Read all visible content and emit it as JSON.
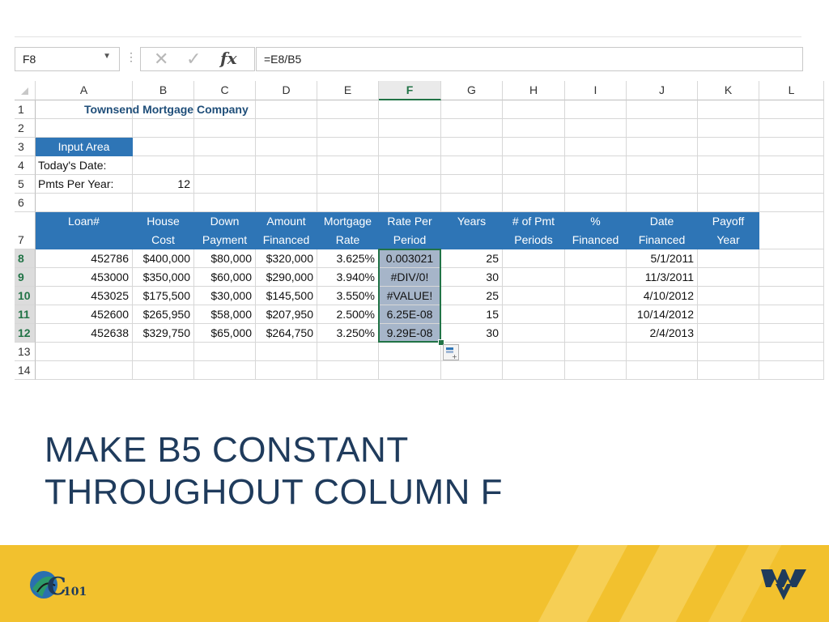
{
  "formula_bar": {
    "name_box": "F8",
    "formula": "=E8/B5",
    "fx_label": "fx",
    "cancel_glyph": "✕",
    "enter_glyph": "✓"
  },
  "columns": [
    "A",
    "B",
    "C",
    "D",
    "E",
    "F",
    "G",
    "H",
    "I",
    "J",
    "K",
    "L"
  ],
  "selected_column": "F",
  "rows": {
    "r1": {
      "num": "1",
      "A": "Townsend Mortgage Company"
    },
    "r2": {
      "num": "2"
    },
    "r3": {
      "num": "3",
      "A": "Input Area"
    },
    "r4": {
      "num": "4",
      "A": "Today's Date:"
    },
    "r5": {
      "num": "5",
      "A": "Pmts Per Year:",
      "B": "12"
    },
    "r6": {
      "num": "6"
    },
    "r7": {
      "num": "7",
      "A": [
        "",
        "Loan#"
      ],
      "B": [
        "House",
        "Cost"
      ],
      "C": [
        "Down",
        "Payment"
      ],
      "D": [
        "Amount",
        "Financed"
      ],
      "E": [
        "Mortgage",
        "Rate"
      ],
      "F": [
        "Rate Per",
        "Period"
      ],
      "G": [
        "",
        "Years"
      ],
      "H": [
        "# of Pmt",
        "Periods"
      ],
      "I": [
        "%",
        "Financed"
      ],
      "J": [
        "Date",
        "Financed"
      ],
      "K": [
        "Payoff",
        "Year"
      ]
    },
    "r8": {
      "num": "8",
      "A": "452786",
      "B": "$400,000",
      "C": "$80,000",
      "D": "$320,000",
      "E": "3.625%",
      "F": "0.003021",
      "G": "25",
      "J": "5/1/2011"
    },
    "r9": {
      "num": "9",
      "A": "453000",
      "B": "$350,000",
      "C": "$60,000",
      "D": "$290,000",
      "E": "3.940%",
      "F": "#DIV/0!",
      "G": "30",
      "J": "11/3/2011"
    },
    "r10": {
      "num": "10",
      "A": "453025",
      "B": "$175,500",
      "C": "$30,000",
      "D": "$145,500",
      "E": "3.550%",
      "F": "#VALUE!",
      "G": "25",
      "J": "4/10/2012"
    },
    "r11": {
      "num": "11",
      "A": "452600",
      "B": "$265,950",
      "C": "$58,000",
      "D": "$207,950",
      "E": "2.500%",
      "F": "6.25E-08",
      "G": "15",
      "J": "10/14/2012"
    },
    "r12": {
      "num": "12",
      "A": "452638",
      "B": "$329,750",
      "C": "$65,000",
      "D": "$264,750",
      "E": "3.250%",
      "F": "9.29E-08",
      "G": "30",
      "J": "2/4/2013"
    },
    "r13": {
      "num": "13"
    },
    "r14": {
      "num": "14"
    }
  },
  "slide": {
    "title_line1": "MAKE B5 CONSTANT",
    "title_line2": "THROUGHOUT COLUMN F"
  },
  "footer": {
    "left_logo_text": "101",
    "left_logo_letter": "C"
  },
  "colors": {
    "header_fill": "#2e75b6",
    "selection_fill": "#a6b5c9",
    "excel_green": "#217346",
    "title_color": "#1f3b5c",
    "footer_gold": "#f2c12e",
    "wvu_navy": "#1f3b5c"
  }
}
